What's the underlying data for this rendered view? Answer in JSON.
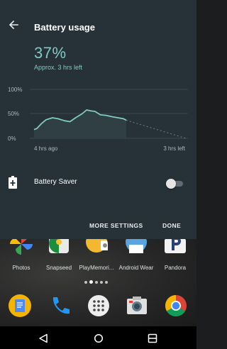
{
  "header": {
    "title": "Battery usage"
  },
  "battery": {
    "percent": "37%",
    "estimate": "Approx. 3 hrs left",
    "accent_color": "#80cbc4"
  },
  "chart_data": {
    "type": "area",
    "y_tick_labels": [
      "100%",
      "50%",
      "0%"
    ],
    "x_tick_labels": [
      "4 hrs ago",
      "3 hrs left"
    ],
    "ylim": [
      0,
      100
    ],
    "grid": true,
    "actual": {
      "x": [
        0,
        0.03,
        0.08,
        0.13,
        0.2,
        0.26,
        0.33,
        0.39,
        0.45,
        0.52,
        0.57,
        0.62,
        0.66,
        0.72,
        0.78,
        0.85,
        0.91,
        0.97,
        1.0
      ],
      "y": [
        18,
        20,
        30,
        38,
        42,
        40,
        36,
        34,
        42,
        50,
        58,
        56,
        55,
        48,
        47,
        44,
        42,
        40,
        37
      ]
    },
    "projection": {
      "from": 37,
      "to": 0
    }
  },
  "battery_saver": {
    "label": "Battery Saver",
    "enabled": false
  },
  "actions": {
    "more_settings": "MORE SETTINGS",
    "done": "DONE"
  },
  "home_apps": [
    {
      "label": "Photos",
      "icon": "photos-icon"
    },
    {
      "label": "Snapseed",
      "icon": "snapseed-icon"
    },
    {
      "label": "PlayMemori...",
      "icon": "playmemories-icon"
    },
    {
      "label": "Android Wear",
      "icon": "android-wear-icon"
    },
    {
      "label": "Pandora",
      "icon": "pandora-icon"
    }
  ],
  "pager": {
    "count": 5,
    "active_index": 1
  },
  "dock": [
    "docs-icon",
    "phone-icon",
    "app-drawer-icon",
    "camera-icon",
    "chrome-icon"
  ],
  "nav": [
    "back-icon",
    "home-icon",
    "recents-icon"
  ]
}
